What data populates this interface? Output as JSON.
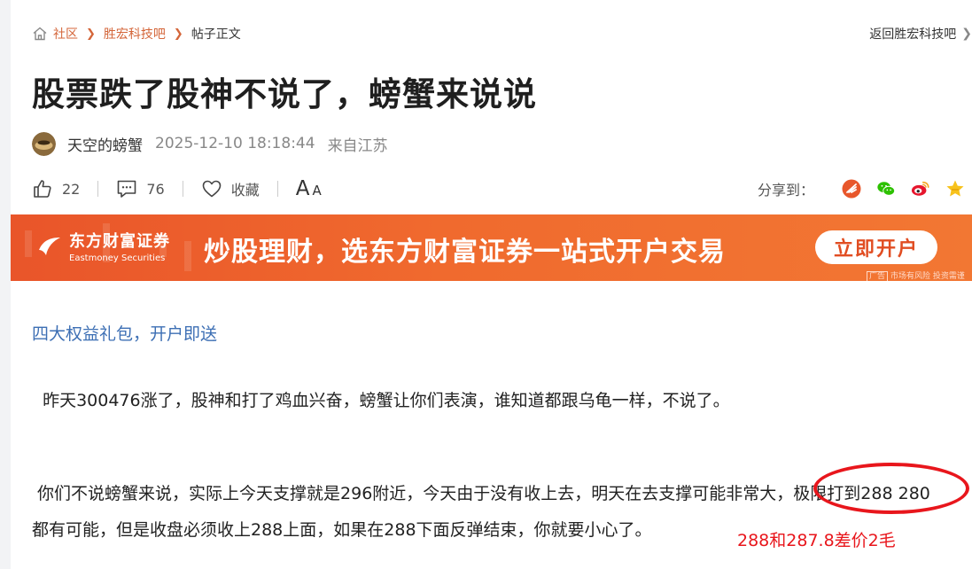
{
  "breadcrumb": {
    "items": [
      "社区",
      "胜宏科技吧",
      "帖子正文"
    ],
    "back_link": "返回胜宏科技吧"
  },
  "post": {
    "title": "股票跌了股神不说了，螃蟹来说说",
    "author": "天空的螃蟹",
    "time": "2025-12-10 18:18:44",
    "location": "来自江苏"
  },
  "actions": {
    "like_count": "22",
    "comment_count": "76",
    "collect_label": "收藏",
    "font_big": "A",
    "font_small": "A",
    "share_label": "分享到："
  },
  "banner": {
    "brand_cn": "东方财富证券",
    "brand_en": "Eastmoney Securities",
    "slogan": "炒股理财，选东方财富证券一站式开户交易",
    "cta": "立即开户",
    "ad_tag": "广告",
    "risk": "市场有风险 投资需谨"
  },
  "content": {
    "promo_link": "四大权益礼包，开户即送",
    "para1": "  昨天300476涨了，股神和打了鸡血兴奋，螃蟹让你们表演，谁知道都跟乌龟一样，不说了。",
    "para2": " 你们不说螃蟹来说，实际上今天支撑就是296附近，今天由于没有收上去，明天在去支撑可能非常大，极限打到288 280",
    "para3": "都有可能，但是收盘必须收上288上面，如果在288下面反弹结束，你就要小心了。",
    "annotation": "288和287.8差价2毛"
  },
  "colors": {
    "link": "#d4663a",
    "promo": "#3d6fb4",
    "banner": "#ee6129",
    "annotation": "#e8161c"
  }
}
